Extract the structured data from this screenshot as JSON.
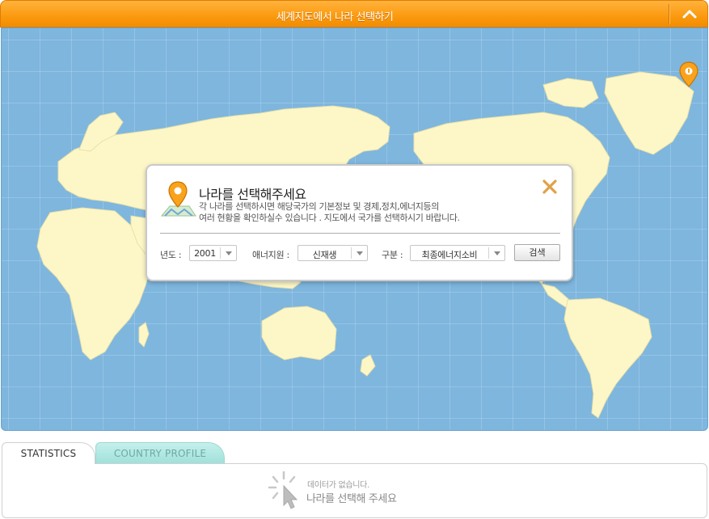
{
  "header": {
    "title": "세계지도에서 나라 선택하기",
    "collapse_icon": "chevron-up-icon"
  },
  "map": {
    "ocean_color": "#7eb6de",
    "land_color": "#fdf7c8",
    "pin_icon": "location-pin-icon"
  },
  "dialog": {
    "title": "나라를 선택해주세요",
    "desc_line1": "각 나라를 선택하시면 해당국가의 기본정보 및 경제,정치,에너지등의",
    "desc_line2": "여러 현황을 확인하실수 있습니다 . 지도에서 국가를 선택하시기 바랍니다.",
    "close_icon": "close-icon",
    "filters": {
      "year_label": "년도 :",
      "year_value": "2001",
      "energy_label": "애너지원 :",
      "energy_value": "신재생",
      "type_label": "구분 :",
      "type_value": "최종에너지소비"
    },
    "search_label": "검색"
  },
  "tabs": {
    "statistics": "STATISTICS",
    "country_profile": "COUNTRY PROFILE"
  },
  "bottom": {
    "no_data": "데이터가 없습니다.",
    "select_country": "나라를 선택해 주세요"
  },
  "colors": {
    "accent": "#fb9a0f",
    "tab_active_bg": "#ffffff",
    "tab_inactive_bg": "#a9e4de"
  }
}
